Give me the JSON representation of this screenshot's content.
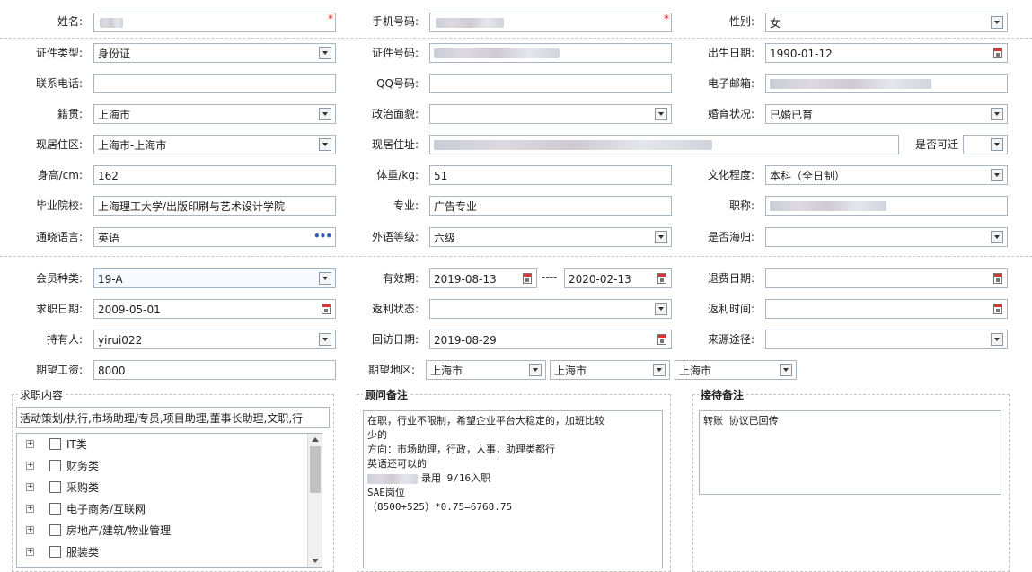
{
  "labels": {
    "name": "姓名:",
    "mobile": "手机号码:",
    "gender": "性别:",
    "id_type": "证件类型:",
    "id_no": "证件号码:",
    "birth": "出生日期:",
    "phone": "联系电话:",
    "qq": "QQ号码:",
    "email": "电子邮箱:",
    "native": "籍贯:",
    "politics": "政治面貌:",
    "marital": "婚育状况:",
    "residence": "现居住区:",
    "address": "现居住址:",
    "relocate": "是否可迁",
    "height": "身高/cm:",
    "weight": "体重/kg:",
    "education": "文化程度:",
    "school": "毕业院校:",
    "major": "专业:",
    "title": "职称:",
    "language": "通晓语言:",
    "foreign_level": "外语等级:",
    "returnee": "是否海归:",
    "member_type": "会员种类:",
    "valid_period": "有效期:",
    "period_sep": "----",
    "refund_date": "退费日期:",
    "job_date": "求职日期:",
    "rebate_status": "返利状态:",
    "rebate_time": "返利时间:",
    "holder": "持有人:",
    "visit_date": "回访日期:",
    "source": "来源途径:",
    "salary": "期望工资:",
    "area": "期望地区:"
  },
  "values": {
    "gender": "女",
    "id_type": "身份证",
    "birth": "1990-01-12",
    "native": "上海市",
    "marital": "已婚已育",
    "residence": "上海市-上海市",
    "height": "162",
    "weight": "51",
    "education": "本科（全日制）",
    "school": "上海理工大学/出版印刷与艺术设计学院",
    "major": "广告专业",
    "language": "英语",
    "foreign_level": "六级",
    "member_type": "19-A",
    "valid_from": "2019-08-13",
    "valid_to": "2020-02-13",
    "job_date": "2009-05-01",
    "holder": "yirui022",
    "visit_date": "2019-08-29",
    "salary": "8000",
    "area1": "上海市",
    "area2": "上海市",
    "area3": "上海市",
    "required_mark": "*"
  },
  "job_section": {
    "title": "求职内容",
    "selected": "活动策划/执行,市场助理/专员,项目助理,董事长助理,文职,行",
    "tree": [
      "IT类",
      "财务类",
      "采购类",
      "电子商务/互联网",
      "房地产/建筑/物业管理",
      "服装类"
    ],
    "expand_symbol": "+"
  },
  "consultant_note": {
    "title": "顾问备注",
    "lines": [
      "在职，行业不限制，希望企业平台大稳定的，加班比较",
      "少的",
      "方向：市场助理，行政，人事，助理类都行",
      "英语还可以的",
      "录用 9/16入职",
      "SAE岗位",
      "（8500+525）*0.75=6768.75"
    ]
  },
  "reception_note": {
    "title": "接待备注",
    "text": "转账 协议已回传"
  },
  "icons": {
    "more": "•••"
  }
}
